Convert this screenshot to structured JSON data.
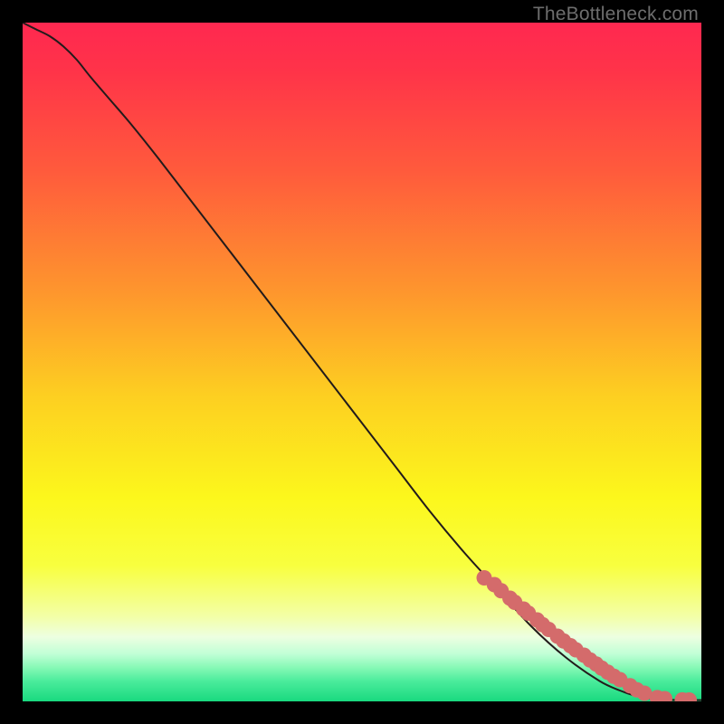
{
  "watermark": "TheBottleneck.com",
  "colors": {
    "curve_stroke": "#221b1b",
    "point_fill": "#d46b6b",
    "frame": "#000000"
  },
  "chart_data": {
    "type": "line",
    "title": "",
    "xlabel": "",
    "ylabel": "",
    "xlim": [
      0,
      100
    ],
    "ylim": [
      0,
      100
    ],
    "gradient_stops": [
      {
        "offset": 0.0,
        "color": "#ff2850"
      },
      {
        "offset": 0.07,
        "color": "#ff3349"
      },
      {
        "offset": 0.22,
        "color": "#ff5b3c"
      },
      {
        "offset": 0.4,
        "color": "#fe972d"
      },
      {
        "offset": 0.55,
        "color": "#fdcf21"
      },
      {
        "offset": 0.7,
        "color": "#fcf71c"
      },
      {
        "offset": 0.8,
        "color": "#f8ff3f"
      },
      {
        "offset": 0.875,
        "color": "#f3ffa7"
      },
      {
        "offset": 0.905,
        "color": "#edffe1"
      },
      {
        "offset": 0.93,
        "color": "#c1ffd6"
      },
      {
        "offset": 0.95,
        "color": "#87f9b6"
      },
      {
        "offset": 0.97,
        "color": "#4bec9c"
      },
      {
        "offset": 1.0,
        "color": "#19d97f"
      }
    ],
    "series": [
      {
        "name": "curve",
        "type": "line",
        "x": [
          0,
          2,
          4,
          6,
          8,
          10,
          13,
          16,
          20,
          25,
          30,
          35,
          40,
          45,
          50,
          55,
          60,
          65,
          70,
          75,
          80,
          85,
          88,
          90,
          92,
          94,
          96,
          98,
          100
        ],
        "y": [
          100,
          99,
          98,
          96.5,
          94.5,
          92,
          88.5,
          85,
          80,
          73.5,
          67,
          60.5,
          54,
          47.5,
          41,
          34.5,
          28,
          22,
          16.5,
          11,
          6.5,
          3,
          1.6,
          0.9,
          0.5,
          0.3,
          0.2,
          0.18,
          0.18
        ]
      },
      {
        "name": "points",
        "type": "scatter",
        "x": [
          68,
          69.5,
          70.5,
          71.8,
          72.5,
          73.8,
          74.5,
          75.8,
          76.6,
          77.5,
          78.8,
          79.7,
          80.7,
          81.5,
          82.7,
          83.6,
          84.5,
          85.3,
          86.2,
          87.1,
          88,
          89.5,
          90.5,
          91.6,
          93.5,
          94.6,
          97.2,
          98.2
        ],
        "y": [
          18.2,
          17.2,
          16.3,
          15.2,
          14.6,
          13.6,
          13.0,
          12.0,
          11.3,
          10.6,
          9.6,
          8.9,
          8.2,
          7.6,
          6.8,
          6.1,
          5.5,
          4.9,
          4.3,
          3.7,
          3.2,
          2.3,
          1.7,
          1.2,
          0.55,
          0.4,
          0.22,
          0.2
        ]
      }
    ]
  }
}
